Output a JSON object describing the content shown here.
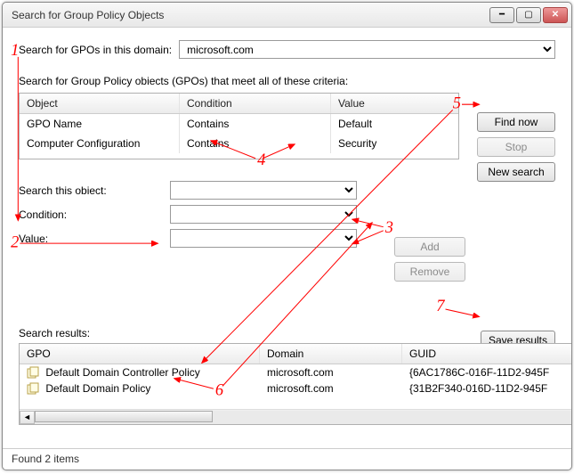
{
  "window": {
    "title": "Search for Group Policy Objects"
  },
  "domain_row": {
    "label": "Search for GPOs in this domain:",
    "value": "microsoft.com"
  },
  "criteria_label": "Search for Group Policy obiects (GPOs) that meet all of these criteria:",
  "criteria_table": {
    "headers": {
      "object": "Object",
      "condition": "Condition",
      "value": "Value"
    },
    "rows": [
      {
        "object": "GPO Name",
        "condition": "Contains",
        "value": "Default"
      },
      {
        "object": "Computer Configuration",
        "condition": "Contains",
        "value": "Security"
      }
    ]
  },
  "side_buttons": {
    "find": "Find now",
    "stop": "Stop",
    "new": "New search"
  },
  "form": {
    "search_object_label": "Search this obiect:",
    "condition_label": "Condition:",
    "value_label": "Value:",
    "add": "Add",
    "remove": "Remove"
  },
  "save_results": "Save results",
  "results_label": "Search results:",
  "results_headers": {
    "gpo": "GPO",
    "domain": "Domain",
    "guid": "GUID"
  },
  "results_rows": [
    {
      "gpo": "Default Domain Controller  Policy",
      "domain": "microsoft.com",
      "guid": "{6AC1786C-016F-11D2-945F"
    },
    {
      "gpo": "Default Domain Policy",
      "domain": "microsoft.com",
      "guid": "{31B2F340-016D-11D2-945F"
    }
  ],
  "status": "Found 2 items",
  "annotations": [
    "1",
    "2",
    "3",
    "4",
    "5",
    "6",
    "7"
  ]
}
